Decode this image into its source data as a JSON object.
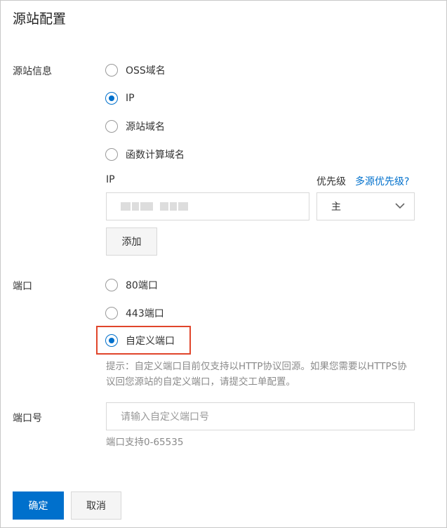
{
  "title": "源站配置",
  "origin": {
    "label": "源站信息",
    "options": [
      {
        "label": "OSS域名",
        "checked": false
      },
      {
        "label": "IP",
        "checked": true
      },
      {
        "label": "源站域名",
        "checked": false
      },
      {
        "label": "函数计算域名",
        "checked": false
      }
    ],
    "ip_label": "IP",
    "priority_label": "优先级",
    "priority_link": "多源优先级?",
    "priority_value": "主",
    "add_button": "添加"
  },
  "port": {
    "label": "端口",
    "options": [
      {
        "label": "80端口",
        "checked": false
      },
      {
        "label": "443端口",
        "checked": false
      },
      {
        "label": "自定义端口",
        "checked": true
      }
    ],
    "hint_line1": "提示：自定义端口目前仅支持以HTTP协议回源。如果您需要以HTTPS协",
    "hint_line2": "议回您源站的自定义端口，请提交工单配置。"
  },
  "port_number": {
    "label": "端口号",
    "placeholder": "请输入自定义端口号",
    "range_hint": "端口支持0-65535"
  },
  "footer": {
    "confirm": "确定",
    "cancel": "取消"
  },
  "colors": {
    "accent": "#0070cc",
    "highlight": "#e0452b"
  }
}
